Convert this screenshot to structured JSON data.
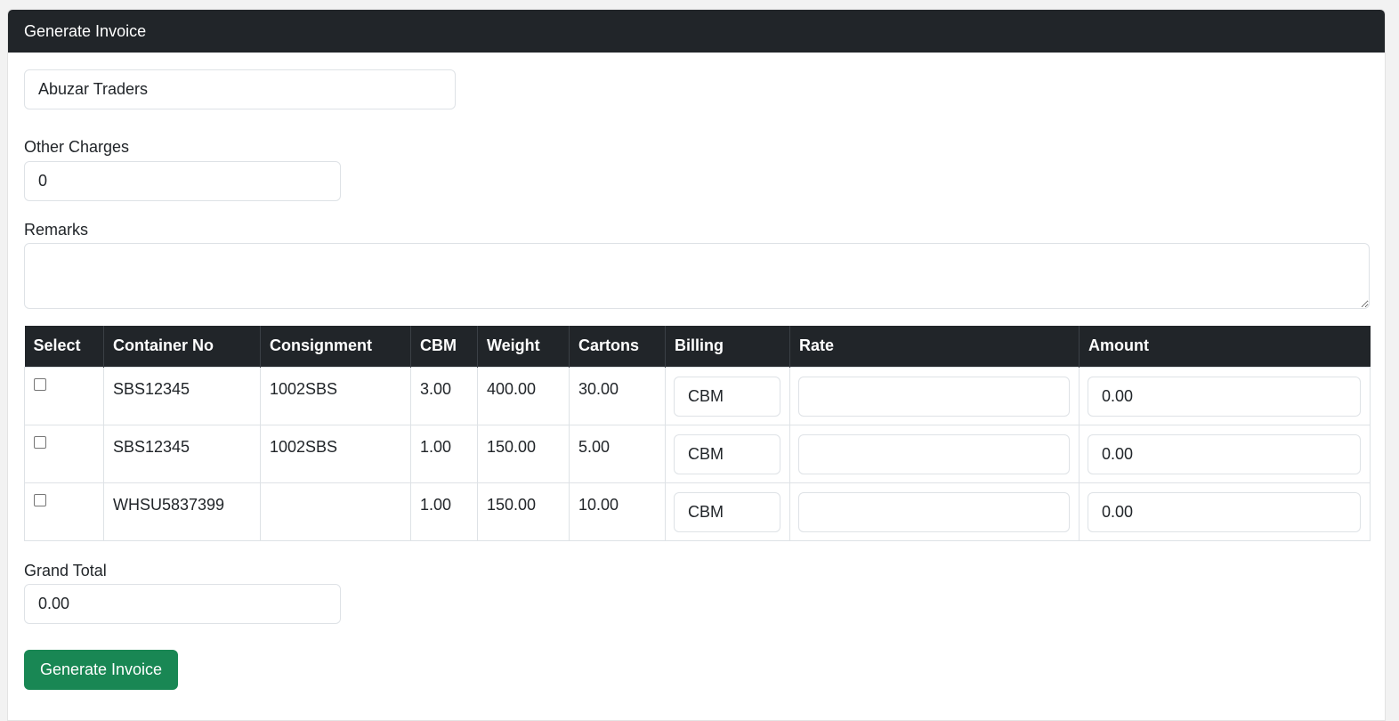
{
  "header": {
    "title": "Generate Invoice"
  },
  "form": {
    "customer_value": "Abuzar Traders",
    "other_charges_label": "Other Charges",
    "other_charges_value": "0",
    "remarks_label": "Remarks",
    "remarks_value": "",
    "grand_total_label": "Grand Total",
    "grand_total_value": "0.00"
  },
  "table": {
    "columns": [
      "Select",
      "Container No",
      "Consignment",
      "CBM",
      "Weight",
      "Cartons",
      "Billing",
      "Rate",
      "Amount"
    ],
    "rows": [
      {
        "selected": false,
        "container_no": "SBS12345",
        "consignment": "1002SBS",
        "cbm": "3.00",
        "weight": "400.00",
        "cartons": "30.00",
        "billing": "CBM",
        "rate": "",
        "amount": "0.00"
      },
      {
        "selected": false,
        "container_no": "SBS12345",
        "consignment": "1002SBS",
        "cbm": "1.00",
        "weight": "150.00",
        "cartons": "5.00",
        "billing": "CBM",
        "rate": "",
        "amount": "0.00"
      },
      {
        "selected": false,
        "container_no": "WHSU5837399",
        "consignment": "",
        "cbm": "1.00",
        "weight": "150.00",
        "cartons": "10.00",
        "billing": "CBM",
        "rate": "",
        "amount": "0.00"
      }
    ]
  },
  "actions": {
    "generate_label": "Generate Invoice"
  },
  "colors": {
    "header_bg": "#212529",
    "button_bg": "#198754",
    "border": "#dee2e6"
  }
}
